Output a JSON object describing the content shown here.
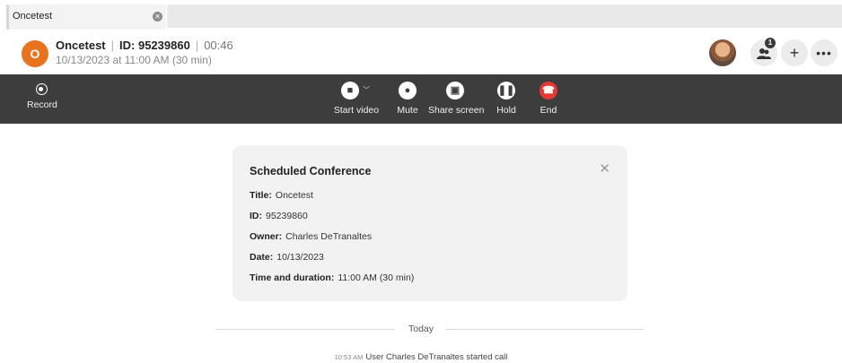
{
  "tab": {
    "label": "Oncetest"
  },
  "header": {
    "avatar_letter": "O",
    "name": "Oncetest",
    "id_text": "ID: 95239860",
    "timer": "00:46",
    "schedule": "10/13/2023 at 11:00 AM (30 min)",
    "participants_badge": "1"
  },
  "toolbar": {
    "record_label": "Record",
    "start_video_label": "Start video",
    "mute_label": "Mute",
    "share_screen_label": "Share screen",
    "hold_label": "Hold",
    "end_label": "End"
  },
  "card": {
    "title": "Scheduled Conference",
    "rows": [
      {
        "key": "Title:",
        "value": "Oncetest"
      },
      {
        "key": "ID:",
        "value": "95239860"
      },
      {
        "key": "Owner:",
        "value": "Charles DeTranaltes"
      },
      {
        "key": "Date:",
        "value": "10/13/2023"
      },
      {
        "key": "Time and duration:",
        "value": "11:00 AM (30 min)"
      }
    ]
  },
  "log": {
    "divider_label": "Today",
    "entry_time": "10:53 AM",
    "entry_text": "User Charles DeTranaltes started call"
  },
  "colors": {
    "avatar": "#e8731e",
    "toolbar_bg": "#3d3d3d",
    "end_button": "#e53935",
    "card_bg": "#f2f2f2"
  }
}
